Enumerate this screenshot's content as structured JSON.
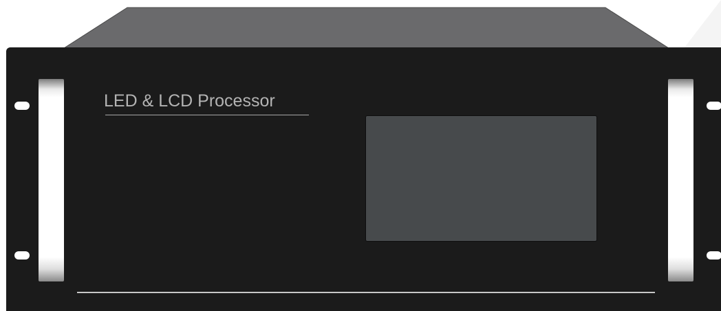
{
  "device": {
    "brand_label": "LED & LCD Processor"
  },
  "colors": {
    "chassis_top": "#6a6a6c",
    "front_panel": "#1b1b1b",
    "lcd_screen": "#474a4c",
    "handle": "#ffffff",
    "label_text": "#b3b3b3"
  }
}
